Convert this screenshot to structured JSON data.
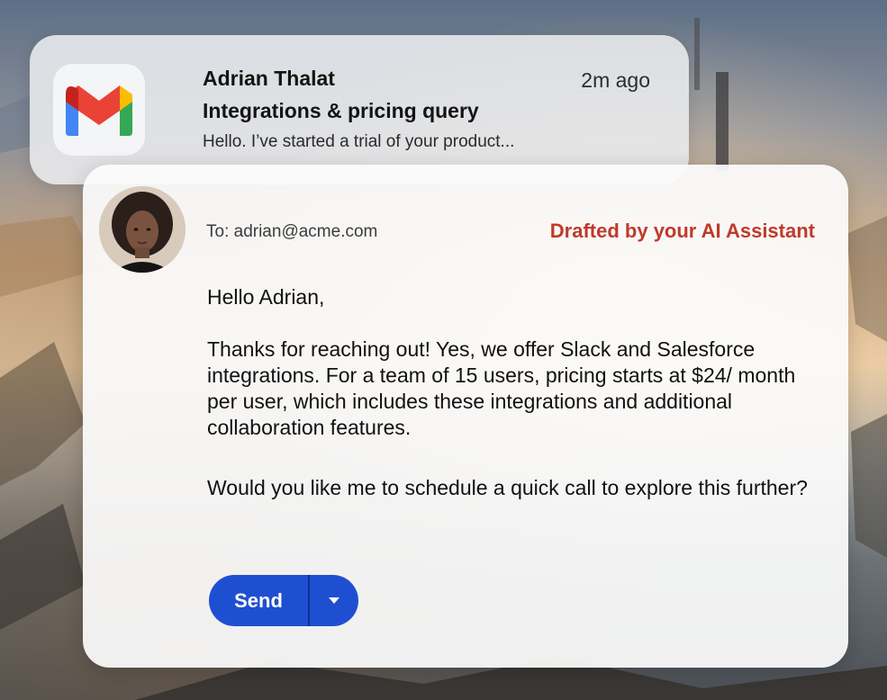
{
  "notification": {
    "app_icon": "gmail-icon",
    "sender": "Adrian Thalat",
    "time": "2m ago",
    "subject": "Integrations & pricing query",
    "preview": "Hello. I’ve started a trial of your  product..."
  },
  "draft": {
    "avatar_icon": "avatar",
    "to": "To: adrian@acme.com",
    "ai_label": "Drafted by your AI Assistant",
    "ai_label_color": "#c0392b",
    "greeting": "Hello Adrian,",
    "paragraph1": "Thanks for reaching out! Yes, we offer Slack and Salesforce integrations. For a team of 15 users, pricing starts at $24/ month per user, which includes these integrations and additional collaboration features.",
    "paragraph2": "Would you like me to schedule a quick call to explore this further?",
    "send_label": "Send",
    "dropdown_icon": "caret-down-icon",
    "send_color": "#1f4fd1"
  }
}
